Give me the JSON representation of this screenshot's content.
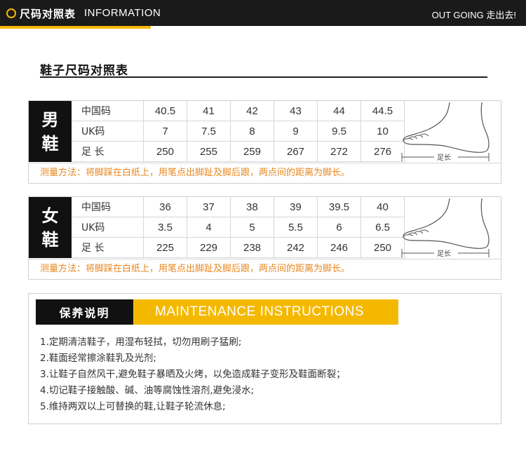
{
  "header": {
    "title_cn": "尺码对照表",
    "title_en": "INFORMATION",
    "slogan": "OUT GOING 走出去!",
    "accent_color": "#f5b800"
  },
  "section_heading": "鞋子尺码对照表",
  "men": {
    "gender_char_1": "男",
    "gender_char_2": "鞋",
    "rows": [
      {
        "label": "中国码",
        "values": [
          "40.5",
          "41",
          "42",
          "43",
          "44",
          "44.5"
        ]
      },
      {
        "label": "UK码",
        "values": [
          "7",
          "7.5",
          "8",
          "9",
          "9.5",
          "10"
        ]
      },
      {
        "label": "足 长",
        "values": [
          "250",
          "255",
          "259",
          "267",
          "272",
          "276"
        ]
      }
    ],
    "foot_label": "足长",
    "note": "测量方法：将脚踩在白纸上，用笔点出脚趾及脚后跟，两点间的距离为脚长。"
  },
  "women": {
    "gender_char_1": "女",
    "gender_char_2": "鞋",
    "rows": [
      {
        "label": "中国码",
        "values": [
          "36",
          "37",
          "38",
          "39",
          "39.5",
          "40"
        ]
      },
      {
        "label": "UK码",
        "values": [
          "3.5",
          "4",
          "5",
          "5.5",
          "6",
          "6.5"
        ]
      },
      {
        "label": "足 长",
        "values": [
          "225",
          "229",
          "238",
          "242",
          "246",
          "250"
        ]
      }
    ],
    "foot_label": "足长",
    "note": "测量方法：将脚踩在白纸上，用笔点出脚趾及脚后跟，两点间的距离为脚长。"
  },
  "maintenance": {
    "title_cn": "保养说明",
    "title_en": "MAINTENANCE INSTRUCTIONS",
    "items": [
      "1.定期清洁鞋子，用湿布轻拭，切勿用刷子猛刷;",
      "2.鞋面经常擦涂鞋乳及光剂;",
      "3.让鞋子自然风干,避免鞋子暴晒及火烤，以免造成鞋子变形及鞋面断裂；",
      "4.切记鞋子接触酸、碱、油等腐蚀性溶剂,避免浸水;",
      "5.维持两双以上可替换的鞋,让鞋子轮流休息;"
    ]
  }
}
